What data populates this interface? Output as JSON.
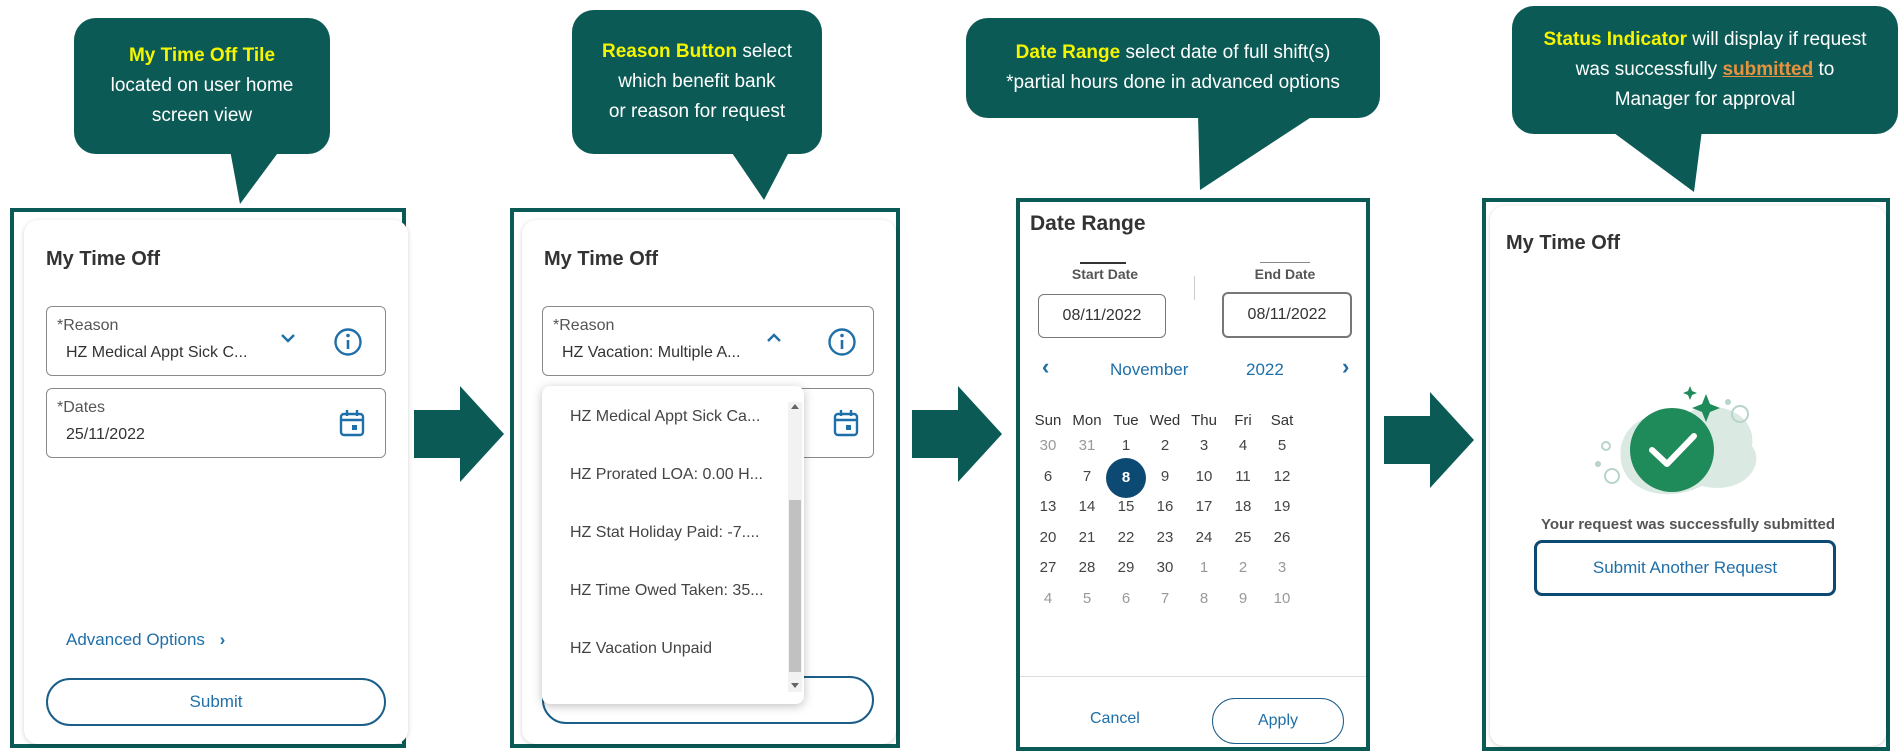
{
  "callouts": {
    "c1": {
      "highlight": "My Time Off Tile",
      "line1_rest": "",
      "line2": "located on user home",
      "line3": "screen view"
    },
    "c2": {
      "highlight": "Reason Button",
      "line1_rest": " select",
      "line2": "which benefit bank",
      "line3": "or reason for request"
    },
    "c3": {
      "highlight": "Date Range",
      "line1_rest": " select date of full shift(s)",
      "line2": "*partial hours done in advanced options"
    },
    "c4": {
      "highlight": "Status Indicator",
      "line1_rest": " will display if request",
      "line2_pre": "was successfully ",
      "line2_link": "submitted",
      "line2_post": " to",
      "line3": "Manager for approval"
    }
  },
  "panel1": {
    "title": "My Time Off",
    "reason_label": "Reason",
    "reason_value": "HZ Medical Appt Sick C...",
    "dates_label": "Dates",
    "dates_value": "25/11/2022",
    "advanced_options": "Advanced Options",
    "submit": "Submit"
  },
  "panel2": {
    "title": "My Time Off",
    "reason_label": "Reason",
    "reason_value": "HZ Vacation: Multiple A...",
    "options": [
      "HZ Medical Appt Sick Ca...",
      "HZ Prorated LOA: 0.00 H...",
      "HZ Stat Holiday Paid: -7....",
      "HZ Time Owed Taken: 35...",
      "HZ Vacation Unpaid"
    ]
  },
  "panel3": {
    "title": "Date Range",
    "start_tab": "Start Date",
    "end_tab": "End Date",
    "start_value": "08/11/2022",
    "end_value": "08/11/2022",
    "month": "November",
    "year": "2022",
    "weekdays": [
      "Sun",
      "Mon",
      "Tue",
      "Wed",
      "Thu",
      "Fri",
      "Sat"
    ],
    "weeks": [
      [
        "30",
        "31",
        "1",
        "2",
        "3",
        "4",
        "5"
      ],
      [
        "6",
        "7",
        "8",
        "9",
        "10",
        "11",
        "12"
      ],
      [
        "13",
        "14",
        "15",
        "16",
        "17",
        "18",
        "19"
      ],
      [
        "20",
        "21",
        "22",
        "23",
        "24",
        "25",
        "26"
      ],
      [
        "27",
        "28",
        "29",
        "30",
        "1",
        "2",
        "3"
      ],
      [
        "4",
        "5",
        "6",
        "7",
        "8",
        "9",
        "10"
      ]
    ],
    "selected_day": "8",
    "cancel": "Cancel",
    "apply": "Apply"
  },
  "panel4": {
    "title": "My Time Off",
    "success_message": "Your request was successfully submitted",
    "submit_another": "Submit Another Request"
  },
  "colors": {
    "callout_bg": "#0b5a55",
    "highlight": "#f5f500",
    "link": "#1f6fa8",
    "selected_day": "#0d4a73",
    "success_green": "#1f8a5a"
  }
}
